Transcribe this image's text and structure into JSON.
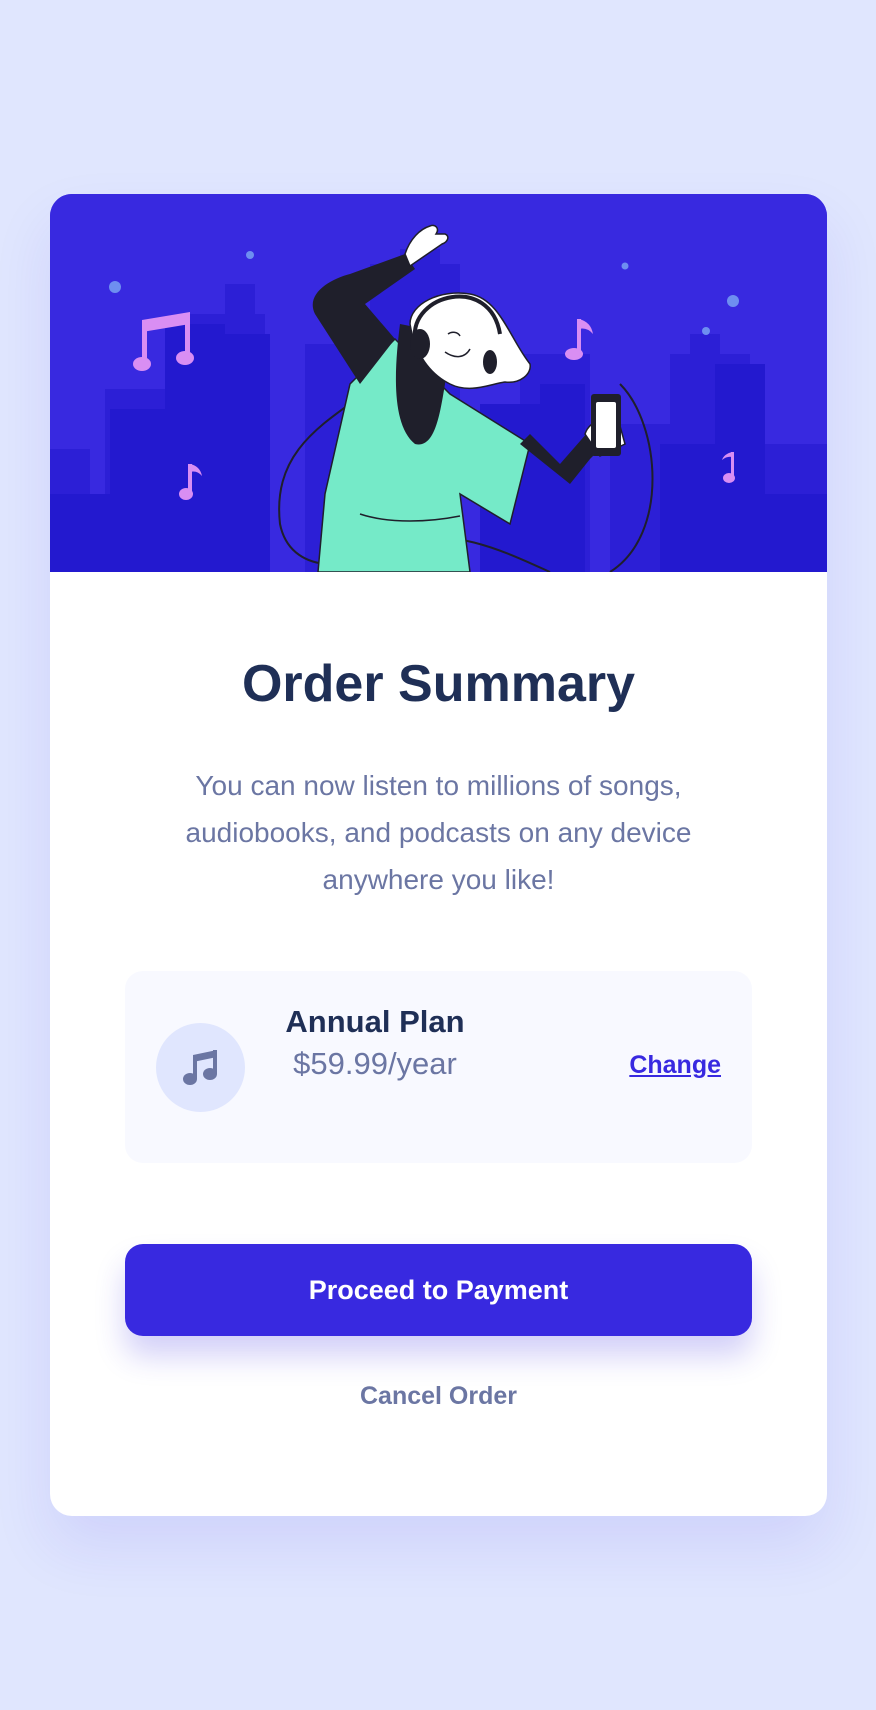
{
  "card": {
    "title": "Order Summary",
    "description": "You can now listen to millions of songs, audiobooks, and podcasts on any device anywhere you like!"
  },
  "plan": {
    "icon": "music-note-icon",
    "name": "Annual Plan",
    "price": "$59.99/year",
    "change_label": "Change"
  },
  "actions": {
    "proceed_label": "Proceed to Payment",
    "cancel_label": "Cancel Order"
  },
  "colors": {
    "background": "#e0e6fe",
    "accent": "#3829e0",
    "heading": "#1f2f56",
    "body_text": "#6b76a3",
    "plan_background": "#f8f9ff"
  }
}
